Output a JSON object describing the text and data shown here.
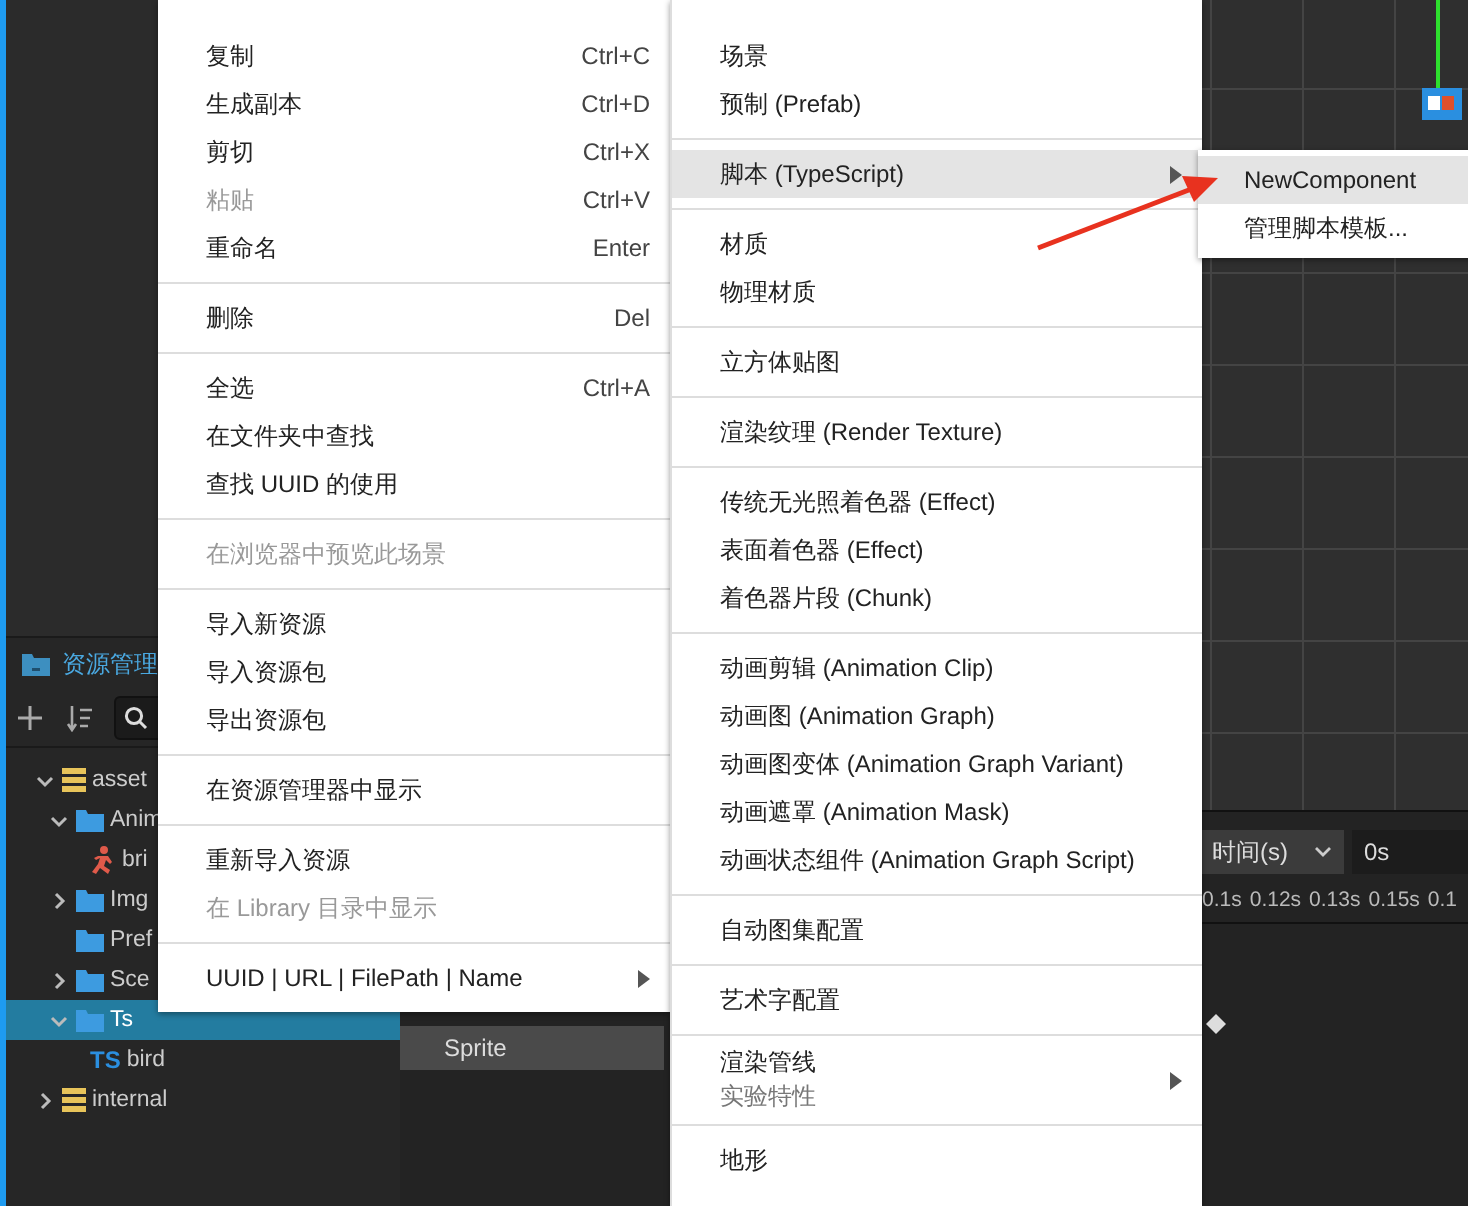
{
  "assets_panel": {
    "title": "资源管理",
    "tree": [
      {
        "label": "asset",
        "kind": "database",
        "expanded": true,
        "selected": false,
        "children": [
          {
            "label": "Anim",
            "kind": "folder",
            "expanded": true,
            "selected": false,
            "children": [
              {
                "label": "bri",
                "kind": "animation",
                "selected": false
              }
            ]
          },
          {
            "label": "Img",
            "kind": "folder",
            "expanded": false,
            "selected": false
          },
          {
            "label": "Pref",
            "kind": "folder",
            "selected": false
          },
          {
            "label": "Sce",
            "kind": "folder",
            "expanded": false,
            "selected": false
          },
          {
            "label": "Ts",
            "kind": "folder",
            "expanded": true,
            "selected": true,
            "children": [
              {
                "label": "bird",
                "kind": "script",
                "badge": "TS",
                "selected": false
              }
            ]
          }
        ]
      },
      {
        "label": "internal",
        "kind": "database",
        "expanded": false,
        "selected": false
      }
    ]
  },
  "timeline": {
    "track": "Sprite",
    "time_unit": "时间(s)",
    "time_value": "0s",
    "ticks": [
      "0.1s",
      "0.12s",
      "0.13s",
      "0.15s",
      "0.1"
    ]
  },
  "context_menu": {
    "items": [
      {
        "kind": "item",
        "label": "复制",
        "shortcut": "Ctrl+C",
        "disabled": false,
        "selected": false
      },
      {
        "kind": "item",
        "label": "生成副本",
        "shortcut": "Ctrl+D",
        "disabled": false,
        "selected": false
      },
      {
        "kind": "item",
        "label": "剪切",
        "shortcut": "Ctrl+X",
        "disabled": false,
        "selected": false
      },
      {
        "kind": "item",
        "label": "粘贴",
        "shortcut": "Ctrl+V",
        "disabled": true,
        "selected": false
      },
      {
        "kind": "item",
        "label": "重命名",
        "shortcut": "Enter",
        "disabled": false,
        "selected": false
      },
      {
        "kind": "separator"
      },
      {
        "kind": "item",
        "label": "删除",
        "shortcut": "Del",
        "disabled": false,
        "selected": false
      },
      {
        "kind": "separator"
      },
      {
        "kind": "item",
        "label": "全选",
        "shortcut": "Ctrl+A",
        "disabled": false,
        "selected": false
      },
      {
        "kind": "item",
        "label": "在文件夹中查找",
        "disabled": false,
        "selected": false
      },
      {
        "kind": "item",
        "label": "查找 UUID 的使用",
        "disabled": false,
        "selected": false
      },
      {
        "kind": "separator"
      },
      {
        "kind": "item",
        "label": "在浏览器中预览此场景",
        "disabled": true,
        "selected": false
      },
      {
        "kind": "separator"
      },
      {
        "kind": "item",
        "label": "导入新资源",
        "disabled": false,
        "selected": false
      },
      {
        "kind": "item",
        "label": "导入资源包",
        "disabled": false,
        "selected": false
      },
      {
        "kind": "item",
        "label": "导出资源包",
        "disabled": false,
        "selected": false
      },
      {
        "kind": "separator"
      },
      {
        "kind": "item",
        "label": "在资源管理器中显示",
        "disabled": false,
        "selected": false
      },
      {
        "kind": "separator"
      },
      {
        "kind": "item",
        "label": "重新导入资源",
        "disabled": false,
        "selected": false
      },
      {
        "kind": "item",
        "label": "在 Library 目录中显示",
        "disabled": true,
        "selected": false
      },
      {
        "kind": "separator"
      },
      {
        "kind": "item",
        "label": "UUID | URL | FilePath | Name",
        "submenu": true,
        "disabled": false,
        "selected": false
      }
    ]
  },
  "create_menu": {
    "items": [
      {
        "kind": "item",
        "label": "场景",
        "disabled": false,
        "selected": false
      },
      {
        "kind": "item",
        "label": "预制 (Prefab)",
        "disabled": false,
        "selected": false
      },
      {
        "kind": "separator"
      },
      {
        "kind": "item",
        "label": "脚本 (TypeScript)",
        "submenu": true,
        "disabled": false,
        "selected": true
      },
      {
        "kind": "separator"
      },
      {
        "kind": "item",
        "label": "材质",
        "disabled": false,
        "selected": false
      },
      {
        "kind": "item",
        "label": "物理材质",
        "disabled": false,
        "selected": false
      },
      {
        "kind": "separator"
      },
      {
        "kind": "item",
        "label": "立方体贴图",
        "disabled": false,
        "selected": false
      },
      {
        "kind": "separator"
      },
      {
        "kind": "item",
        "label": "渲染纹理 (Render Texture)",
        "disabled": false,
        "selected": false
      },
      {
        "kind": "separator"
      },
      {
        "kind": "item",
        "label": "传统无光照着色器 (Effect)",
        "disabled": false,
        "selected": false
      },
      {
        "kind": "item",
        "label": "表面着色器 (Effect)",
        "disabled": false,
        "selected": false
      },
      {
        "kind": "item",
        "label": "着色器片段 (Chunk)",
        "disabled": false,
        "selected": false
      },
      {
        "kind": "separator"
      },
      {
        "kind": "item",
        "label": "动画剪辑 (Animation Clip)",
        "disabled": false,
        "selected": false
      },
      {
        "kind": "item",
        "label": "动画图 (Animation Graph)",
        "disabled": false,
        "selected": false
      },
      {
        "kind": "item",
        "label": "动画图变体 (Animation Graph Variant)",
        "disabled": false,
        "selected": false
      },
      {
        "kind": "item",
        "label": "动画遮罩 (Animation Mask)",
        "disabled": false,
        "selected": false
      },
      {
        "kind": "item",
        "label": "动画状态组件 (Animation Graph Script)",
        "disabled": false,
        "selected": false
      },
      {
        "kind": "separator"
      },
      {
        "kind": "item",
        "label": "自动图集配置",
        "disabled": false,
        "selected": false
      },
      {
        "kind": "separator"
      },
      {
        "kind": "item",
        "label": "艺术字配置",
        "disabled": false,
        "selected": false
      },
      {
        "kind": "separator"
      },
      {
        "kind": "item",
        "label": "渲染管线",
        "note": "实验特性",
        "submenu": true,
        "disabled": false,
        "selected": false
      },
      {
        "kind": "separator"
      },
      {
        "kind": "item",
        "label": "地形",
        "disabled": false,
        "selected": false
      }
    ]
  },
  "script_submenu": {
    "items": [
      {
        "kind": "item",
        "label": "NewComponent",
        "disabled": false,
        "selected": true
      },
      {
        "kind": "item",
        "label": "管理脚本模板...",
        "disabled": false,
        "selected": false
      }
    ]
  }
}
